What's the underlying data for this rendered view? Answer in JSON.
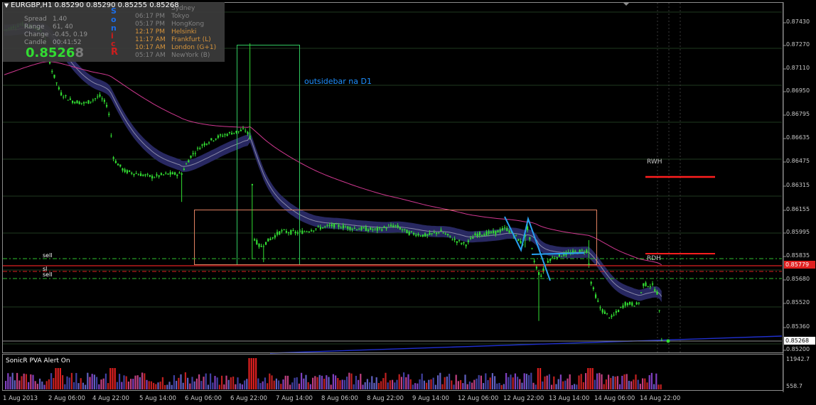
{
  "header": {
    "title": "EURGBP,H1  0.85290 0.85290 0.85255 0.85268"
  },
  "info": {
    "labels": [
      "Spread",
      "Range",
      "Change",
      "Candle"
    ],
    "values": [
      "1.40",
      "61, 40",
      "-0.45, 0.19",
      "00:41:52"
    ],
    "price_main": "0.8526",
    "price_last_digit": "8",
    "sonic_letters": [
      "S",
      "o",
      "n",
      "i",
      "c",
      "R"
    ],
    "sessions": [
      {
        "time": "",
        "city": "Sydney",
        "color": "#8c8c8c"
      },
      {
        "time": "06:17 PM",
        "city": "Tokyo",
        "color": "#8c8c8c"
      },
      {
        "time": "05:17 PM",
        "city": "HongKong",
        "color": "#8c8c8c"
      },
      {
        "time": "12:17 PM",
        "city": "Helsinki",
        "color": "#e8a040"
      },
      {
        "time": "11:17 AM",
        "city": "Frankfurt  (L)",
        "color": "#e8a040"
      },
      {
        "time": "10:17 AM",
        "city": "London  (G+1)",
        "color": "#e8a040"
      },
      {
        "time": "05:17 AM",
        "city": "NewYork  (B)",
        "color": "#8c8c8c"
      }
    ]
  },
  "price_axis": [
    "0.87430",
    "0.87270",
    "0.87110",
    "0.86950",
    "0.86795",
    "0.86635",
    "0.86475",
    "0.86315",
    "0.86155",
    "0.85995",
    "0.85835",
    "0.85680",
    "0.85520",
    "0.85360",
    "0.85200"
  ],
  "current_price_tag": "0.85779",
  "last_price_tag": "0.85268",
  "time_axis": [
    "1 Aug 2013",
    "2 Aug 06:00",
    "4 Aug 22:00",
    "5 Aug 14:00",
    "6 Aug 06:00",
    "6 Aug 22:00",
    "7 Aug 14:00",
    "8 Aug 06:00",
    "8 Aug 22:00",
    "9 Aug 14:00",
    "12 Aug 06:00",
    "12 Aug 22:00",
    "13 Aug 14:00",
    "14 Aug 06:00",
    "14 Aug 22:00"
  ],
  "annotations": {
    "outside_bar": "outsidebar na D1",
    "rwh": "RWH",
    "rdh": "RDH",
    "sell1": "sell",
    "sl": "sl",
    "sell2": "sell"
  },
  "pva": {
    "label": "SonicR PVA   Alert On",
    "max": "11942.7",
    "min": "558.7"
  },
  "colors": {
    "background": "#000000",
    "bull": "#32dc32",
    "dragon": "#2a2a66",
    "ema": "#d03890",
    "annotation": "#1e90ff",
    "resistance": "#ff1e1e"
  }
}
